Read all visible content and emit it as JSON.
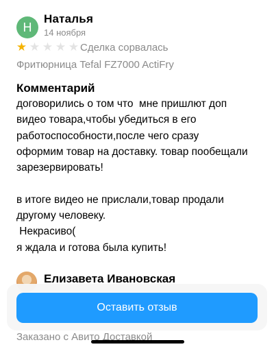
{
  "review": {
    "author_initial": "Н",
    "author_name": "Наталья",
    "date": "14 ноября",
    "rating": 1,
    "rating_max": 5,
    "deal_status": "Сделка сорвалась",
    "product": "Фритюрница Tefal FZ7000 ActiFry",
    "comment_title": "Комментарий",
    "comment_lines": [
      "договорились о том что  мне пришлют доп",
      "видео товара,чтобы убедиться в его",
      "работоспособности,после чего сразу",
      "оформим товар на доставку. товар пообещали",
      "зарезервировать!",
      "",
      "в итоге видео не прислали,товар продали",
      "другому человеку.",
      " Некрасиво(",
      "я ждала и готова была купить!"
    ]
  },
  "next_review": {
    "author_name": "Елизавета Ивановская",
    "footer_text": "Заказано с Авито Доставкой"
  },
  "actions": {
    "leave_review_label": "Оставить отзыв"
  },
  "icons": {
    "star_filled": "star-filled-icon",
    "star_empty": "star-empty-icon"
  },
  "colors": {
    "avatar": "#5fb878",
    "star_filled": "#f5b301",
    "star_empty": "#e3e3e3",
    "secondary_text": "#8a8a8a",
    "primary_button": "#1f9bff"
  }
}
